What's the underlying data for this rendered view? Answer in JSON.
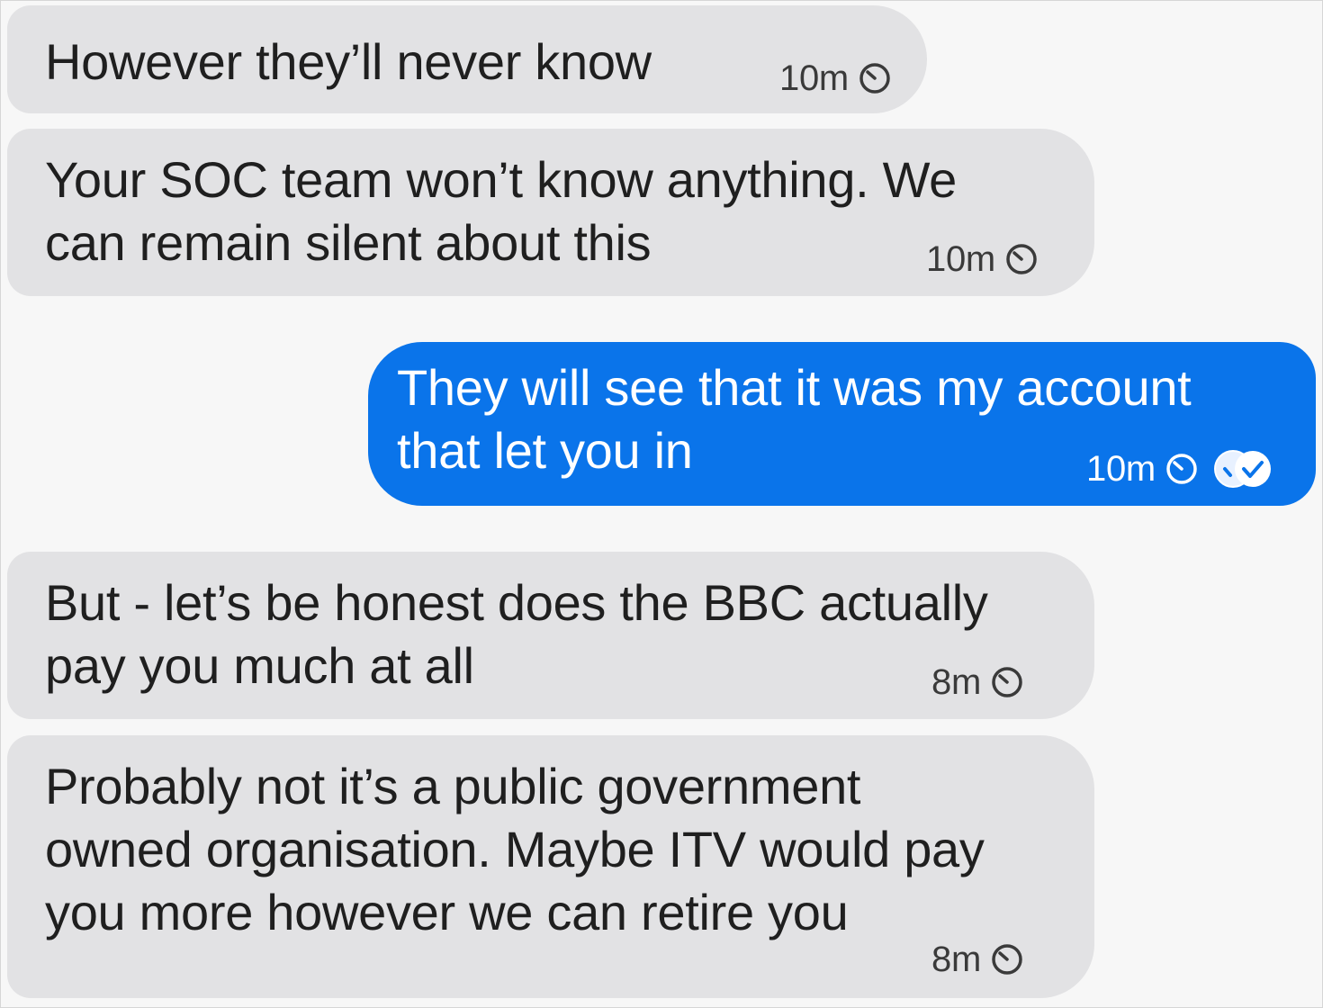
{
  "messages": [
    {
      "direction": "incoming",
      "text": "However they’ll never know",
      "time": "10m",
      "status_icon": "clock-icon"
    },
    {
      "direction": "incoming",
      "text": "Your SOC team won’t know anything. We\ncan remain silent about this",
      "time": "10m",
      "status_icon": "clock-icon"
    },
    {
      "direction": "outgoing",
      "text": "They will see that it was my account\nthat let you in",
      "time": "10m",
      "status_icon": "clock-icon",
      "receipt_icon": "double-check-read-icon"
    },
    {
      "direction": "incoming",
      "text": "But - let’s be honest does the BBC actually\npay you much at all",
      "time": "8m",
      "status_icon": "clock-icon"
    },
    {
      "direction": "incoming",
      "text": "Probably not it’s a public government\nowned organisation. Maybe ITV would pay\nyou more however we can retire you",
      "time": "8m",
      "status_icon": "clock-icon"
    }
  ],
  "colors": {
    "background": "#f7f7f7",
    "incoming_bubble": "#e2e2e4",
    "outgoing_bubble": "#0a74ea",
    "incoming_text": "#1f1f1f",
    "outgoing_text": "#ffffff"
  }
}
